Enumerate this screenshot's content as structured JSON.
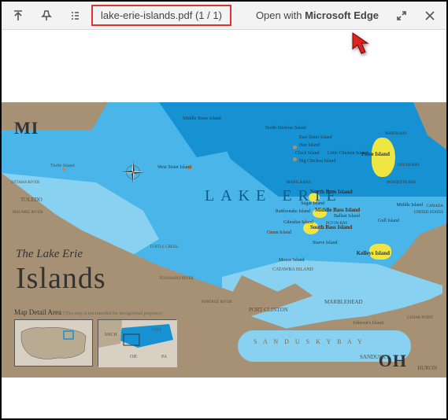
{
  "toolbar": {
    "filename": "lake-erie-islands.pdf",
    "page_indicator": "(1 / 1)",
    "open_with_prefix": "Open with ",
    "open_with_app": "Microsoft Edge"
  },
  "map": {
    "state_mi": "MI",
    "state_oh": "OH",
    "lake_name": "LAKE ERIE",
    "title_line1": "The Lake Erie",
    "title_line2": "Islands",
    "detail_label": "Map Detail Area",
    "detail_sub": "(This map is not intended for navigational purposes)",
    "sandusky_bay": "S A N D U S K Y   B A Y",
    "labels": {
      "middle_sister": "Middle Sister Island",
      "north_harbour": "North Harbour Island",
      "east_sister": "East Sister Island",
      "hen": "Hen Island",
      "chick": "Chick Island",
      "little_chicken": "Little Chicken Island",
      "big_chicken": "Big Chicken Island",
      "west_sister": "West Sister Island",
      "turtle": "Turtle Island",
      "pelee": "Pelee Island",
      "north_bass": "North Bass Island",
      "sugar": "Sugar Island",
      "rattlesnake": "Rattlesnake Island",
      "middle_bass": "Middle Bass Island",
      "ballast": "Ballast Island",
      "gibraltar": "Gibraltar Island",
      "south_bass": "South Bass Island",
      "green": "Green Island",
      "starve": "Starve Island",
      "middle_east": "Middle Island",
      "gull": "Gull Island",
      "mouse": "Mouse Island",
      "kelleys": "Kelleys Island",
      "catawba": "CATAWBA ISLAND",
      "johnsons": "Johnson's Island",
      "marblehead": "MARBLEHEAD",
      "port_clinton": "PORT CLINTON",
      "sandusky": "SANDUSKY",
      "huron": "HURON",
      "toledo": "TOLEDO",
      "maumee_r": "MAUMEE RIVER",
      "ottawa_r": "OTTAWA RIVER",
      "turtle_ck": "TURTLE CREEK",
      "toussaint": "TOUSSAINT RIVER",
      "portage": "PORTAGE RIVER",
      "manila_bay": "MANILA BAY",
      "mosquito_bay": "MOSQUITO BAY",
      "north_bay": "NORTH BAY",
      "south_bay": "SOUTH BAY",
      "putinbay": "PUT-IN-BAY",
      "cedar_pt": "CEDAR POINT",
      "canada": "CANADA",
      "usa": "UNITED STATES",
      "michigan_line": "MICHIGAN",
      "ohio_line": "OHIO"
    }
  }
}
